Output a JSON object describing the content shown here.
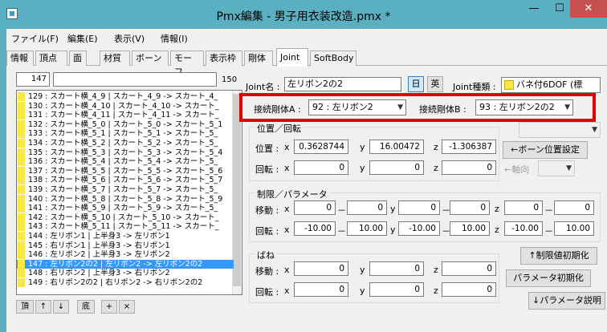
{
  "window": {
    "title": "Pmx編集 - 男子用衣装改造.pmx *",
    "min_glyph": "—",
    "max_glyph": "☐",
    "close_glyph": "✕"
  },
  "menu": [
    "ファイル(F)",
    "編集(E)",
    "表示(V)",
    "情報(I)"
  ],
  "tabs": [
    "情報",
    "頂点",
    "面",
    "材質",
    "ボーン",
    "モーフ",
    "表示枠",
    "剛体",
    "Joint",
    "SoftBody"
  ],
  "active_tab": "Joint",
  "list": {
    "index_value": "147",
    "count": "150",
    "rows": [
      "129 : スカート横_4_9 | スカート_4_9 -> スカート_4_",
      "130 : スカート横_4_10 | スカート_4_10 -> スカート_",
      "131 : スカート横_4_11 | スカート_4_11 -> スカート_",
      "132 : スカート横_5_0 | スカート_5_0 -> スカート_5_1",
      "133 : スカート横_5_1 | スカート_5_1 -> スカート_5_",
      "134 : スカート横_5_2 | スカート_5_2 -> スカート_5_",
      "135 : スカート横_5_3 | スカート_5_3 -> スカート_5_4",
      "136 : スカート横_5_4 | スカート_5_4 -> スカート_5_",
      "137 : スカート横_5_5 | スカート_5_5 -> スカート_5_6",
      "138 : スカート横_5_6 | スカート_5_6 -> スカート_5_7",
      "139 : スカート横_5_7 | スカート_5_7 -> スカート_5_",
      "140 : スカート横_5_8 | スカート_5_8 -> スカート_5_9",
      "141 : スカート横_5_9 | スカート_5_9 -> スカート_5_",
      "142 : スカート横_5_10 | スカート_5_10 -> スカート_",
      "143 : スカート横_5_11 | スカート_5_11 -> スカート_",
      "144 : 左リボン1 | 上半身3 -> 左リボン1",
      "145 : 右リボン1 | 上半身3 -> 右リボン1",
      "146 : 左リボン2 | 上半身3 -> 左リボン2",
      "147 : 左リボン2の2 | 左リボン2 -> 左リボン2の2",
      "148 : 右リボン2 | 上半身3 -> 右リボン2",
      "149 : 右リボン2の2 | 右リボン2 -> 右リボン2の2"
    ],
    "selected_index": 18,
    "buttons": [
      "頂",
      "↑",
      "↓",
      "底",
      "+",
      "×"
    ]
  },
  "joint": {
    "name_label": "Joint名 :",
    "name_value": "左リボン2の2",
    "lang_jp": "日",
    "lang_en": "英",
    "type_label": "Joint種類 :",
    "type_value": "バネ付6DOF (標",
    "rigid_a_label": "接続剛体A :",
    "rigid_a_value": "92 : 左リボン2",
    "rigid_b_label": "接続剛体B :",
    "rigid_b_value": "93 : 左リボン2の2",
    "pos_rot_title": "位置／回転",
    "position_label": "位置 :",
    "rotation_label": "回転 :",
    "pos": {
      "x": "0.3628744",
      "y": "16.00472",
      "z": "-1.306387"
    },
    "rot": {
      "x": "0",
      "y": "0",
      "z": "0"
    },
    "bone_pos_button": "←ボーン位置設定",
    "axis_button": "←軸向",
    "limits_title": "制限／パラメータ",
    "move_label": "移動 :",
    "rot_label": "回転 :",
    "move_limits": {
      "x_min": "0",
      "x_max": "0",
      "y_min": "0",
      "y_max": "0",
      "z_min": "0",
      "z_max": "0"
    },
    "rot_limits": {
      "x_min": "-10.00",
      "x_max": "10.00",
      "y_min": "-10.00",
      "y_max": "10.00",
      "z_min": "-10.00",
      "z_max": "10.00"
    },
    "spring_title": "ばね",
    "spring_move": {
      "x": "0",
      "y": "0",
      "z": "0"
    },
    "spring_rot": {
      "x": "0",
      "y": "0",
      "z": "0"
    },
    "limits_reset_button": "↑制限値初期化",
    "params_reset_button": "パラメータ初期化",
    "params_help_button": "↓パラメータ説明",
    "x": "x",
    "y": "y",
    "z": "z",
    "dash": "－"
  },
  "colors": {
    "frame": "#5ab0c0",
    "highlight": "#e00000",
    "selection": "#3399ff",
    "type_swatch": "#ffe640",
    "list_marker": "#f7e84a"
  }
}
